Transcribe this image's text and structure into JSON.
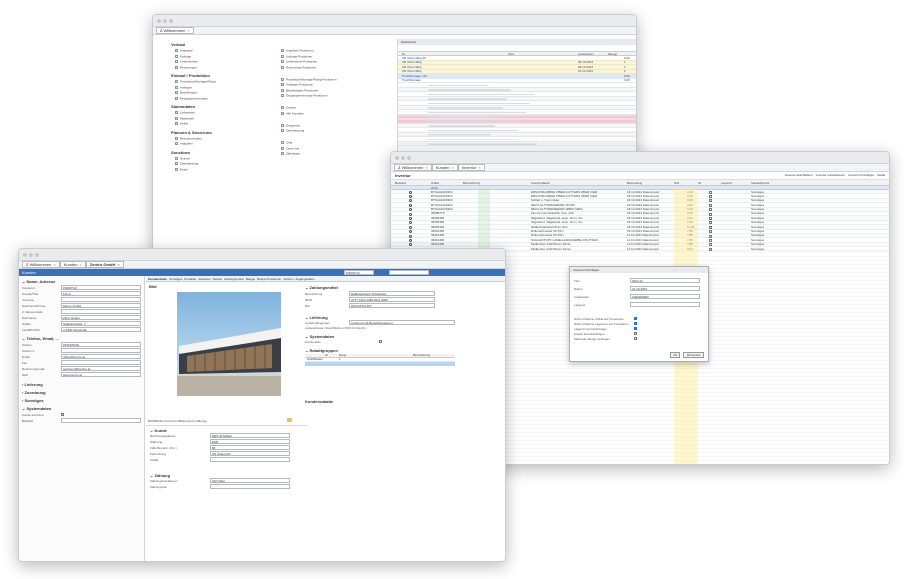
{
  "back_window": {
    "tab_label": "Willkommen",
    "dashboard": {
      "sections": [
        {
          "title": "Verkauf",
          "items": [
            "Angebote",
            "Aufträge",
            "Lieferscheine",
            "Rechnungen"
          ]
        },
        {
          "title": "Einkauf / Produktion",
          "items": [
            "Produktion/Montage/Rüstg",
            "Anfragen",
            "Bestellungen",
            "Eingangsrechnungen"
          ]
        },
        {
          "title": "Stammdaten",
          "items": [
            "Lieferanten",
            "Mitarbeiter",
            "Artikel"
          ]
        },
        {
          "title": "Planung & Steuerung",
          "items": [
            "Ressourcenplan",
            "Aufgaben"
          ]
        },
        {
          "title": "Sonstiges",
          "items": [
            "Notizen",
            "Zeiterfassung",
            "Email"
          ]
        }
      ],
      "right_items": [
        "Angebots-Positionen",
        "Auftrags-Positionen",
        "Lieferschein-Positionen",
        "Rechnungs-Positionen",
        "Produktion/Montage/Rüstg-Positionen",
        "Anfragen-Positionen",
        "Bestellungen-Positionen",
        "Eingangsrechnungs-Positionen",
        "Kunden",
        "Alle Kontakte",
        "Ereignisse",
        "Zeiterfassung",
        "Chat",
        "Zeiten bis",
        "Zahlungen"
      ],
      "list_header": "Dashboard",
      "list_columns": [
        "Nr.",
        "Titel",
        "Lieferdatum",
        "Menge"
      ],
      "list_rows": [
        {
          "c": "AB Übermäßig 35",
          "d": "",
          "q": "0,00"
        },
        {
          "c": "AB Übermäßig",
          "d": "09.10.2024",
          "q": "1"
        },
        {
          "c": "AB Übermäßig",
          "d": "09.10.2024",
          "q": "1"
        },
        {
          "c": "AB Übermäßig",
          "d": "10.11.2024",
          "q": "1"
        },
        {
          "c": "Prod/Montage 179",
          "d": "",
          "q": "0,00"
        },
        {
          "c": "Prod/Montage",
          "d": "",
          "q": "0,00"
        }
      ]
    }
  },
  "inventory_window": {
    "tabs": [
      "Willkommen",
      "Kunden",
      "Inventur"
    ],
    "title": "Inventur",
    "toolbar": [
      "Inventur abschließen",
      "Inventur zurücksetzen",
      "Inventur hinzufügen",
      "Detail"
    ],
    "columns": [
      "Bestand",
      "Artikel",
      "Bezeichnung",
      "Inventurdatum",
      "Bemerkung",
      "Soll",
      "Ist",
      "Lagerort",
      "Verkaufspreis"
    ],
    "rows": [
      {
        "a": "BTSAA1626303",
        "b": "EBS4728LGB66H FIBER-CUTTERS 18MM (VER",
        "d": "18.10.2024 Datenimport",
        "s": "3,29",
        "l": "Sonstiges"
      },
      {
        "a": "BTSAA1626303",
        "b": "EBS4728LGB66H FIBER-CUTTERS 18MM (VER",
        "d": "18.10.2024 Datenimport",
        "s": "3,29",
        "l": "Sonstiges"
      },
      {
        "a": "BTSAA1626303",
        "b": "Schleif u. Trennmittel",
        "d": "18.10.2024 Datenimport",
        "s": "3,29",
        "l": "Sonstiges"
      },
      {
        "a": "BTSAA1626303",
        "b": "REC3-GUTTERKEEPER 18 MM",
        "d": "18.10.2024 Datenimport",
        "s": "3,29",
        "l": "Sonstiges"
      },
      {
        "a": "BTSAA1626303",
        "b": "REC3-GUTTERKEEPER 18MM (VER)",
        "d": "18.10.2024 Datenimport",
        "s": "3,29",
        "l": "Sonstiges"
      },
      {
        "a": "366887T6",
        "b": "Zimmermannsbleistift, lose, 24S",
        "d": "18.10.2024 Datenimport",
        "s": "0,69",
        "l": "Sonstiges"
      },
      {
        "a": "36665483",
        "b": "Sägeband, Sägeband, ansp. 4mm, 3m",
        "d": "18.10.2024 Datenimport",
        "s": "4,61",
        "l": "Sonstiges"
      },
      {
        "a": "36665483",
        "b": "Sägeband, Sägeband, ansp. 4mm, 3m",
        "d": "18.10.2024 Datenimport",
        "s": "2,09",
        "l": "Sonstiges"
      },
      {
        "a": "36665483",
        "b": "Nahlschraubkopf 8mm 10m",
        "d": "18.10.2024 Datenimport",
        "s": "11,39",
        "l": "Sonstiges"
      },
      {
        "a": "36661483",
        "b": "Rollenschneider A5 25m",
        "d": "18.10.2024 Datenimport",
        "s": "7,85",
        "l": "Sonstiges"
      },
      {
        "a": "36661483",
        "b": "Rollenschneider A5 25m",
        "d": "11.10.2024 Datenimport",
        "s": "7,85",
        "l": "Sonstiges"
      },
      {
        "a": "36661483",
        "b": "SCHLEIFTOPF LAMELLENSCHEIBE K36 ZTRAK.",
        "d": "11.10.2024 Datenimport",
        "s": "7,85",
        "l": "Sonstiges"
      },
      {
        "a": "36661483",
        "b": "Mollbecher 24W 80mm 46mm",
        "d": "11.10.2024 Datenimport",
        "s": "7,85",
        "l": "Sonstiges"
      },
      {
        "a": "36661483",
        "b": "Mollbecher 24W 80mm 46mm",
        "d": "11.10.2024 Datenimport",
        "s": "9,07",
        "l": "Sonstiges"
      },
      {
        "a": "36661483",
        "b": "Holzlamelle, 40 mm, Breite 80 mm",
        "d": "11.10.2024 Datenimport",
        "s": "31,98",
        "l": "Sonstiges"
      },
      {
        "a": "36661483",
        "b": "Holzlamelle, 40 mm, Breite 80 mm",
        "d": "11.10.2024 Datenimport",
        "s": "12,27",
        "l": "Sonstiges"
      }
    ],
    "dialog": {
      "title": "Inventur hinzufügen",
      "fields": [
        {
          "label": "Titel",
          "value": "2024-11"
        },
        {
          "label": "Datum",
          "value": "31.10.2024"
        },
        {
          "label": "Lieferanten",
          "value": "LIEFERSER"
        },
        {
          "label": "Lagerort",
          "value": ""
        }
      ],
      "options": [
        "Nicht erhaltene Artikel auf 0 bestehen",
        "Nicht erhaltene Lagerorte auf 0 bestehen",
        "Lagerort berücksichtigen",
        "Zusatz berücksichtigen",
        "Maximale Menge festlegen"
      ],
      "ok": "OK",
      "cancel": "Abbrechen"
    }
  },
  "customer_window": {
    "tabs": [
      "Willkommen",
      "Kunden",
      "Zentro GmbH"
    ],
    "title": "Kunden",
    "record_nr": "P0000712",
    "toolbar_tabs": [
      "Kundendaten",
      "Sonstiges",
      "Kontakte",
      "Adressen, Telefon",
      "Zahlungsmittel",
      "Belege",
      "Belegs-Positionen",
      "Notizen",
      "Zugangsdaten"
    ],
    "left": {
      "section_name": "Name, Adresse",
      "fields": [
        {
          "label": "Kundennr.",
          "value": "P0000712"
        },
        {
          "label": "Anrede/Titel",
          "value": "Firma"
        },
        {
          "label": "Vorname",
          "value": ""
        },
        {
          "label": "Nachname/Firma",
          "value": "Zentro GmbH"
        },
        {
          "label": "2. Namenszeile",
          "value": ""
        },
        {
          "label": "Suchname",
          "value": "Zentr GmbH"
        },
        {
          "label": "Straße",
          "value": "Südbahnhofstr. 7"
        },
        {
          "label": "Land/PLZ/Ort",
          "value": "A   4840   Schwindel"
        }
      ],
      "section_contact": "Telefon, Email, ...",
      "contact_fields": [
        {
          "label": "Telefon",
          "value": "07615/5216"
        },
        {
          "label": "Telefon 2",
          "value": ""
        },
        {
          "label": "Email",
          "value": "office@zentro.at"
        },
        {
          "label": "Fax",
          "value": ""
        },
        {
          "label": "Rechnungsemail",
          "value": "rechnung@zentro.at"
        },
        {
          "label": "Web",
          "value": "www.zentro.at"
        }
      ],
      "collapsed": [
        "Lieferung",
        "Zuordnung",
        "Sonstiges"
      ],
      "section_system": "Systemdaten",
      "system_fields": [
        {
          "label": "Kunde archiviert",
          "value": ""
        },
        {
          "label": "Bildpfad",
          "value": ""
        }
      ]
    },
    "image_block": {
      "title": "Bild",
      "path": "Bild/Bild\\Zentro\\Zentro\\Bilder\\Zentro-Bild.jpg"
    },
    "payment": {
      "title": "Zahlungsmittel",
      "fields": [
        {
          "label": "Bezeichnung",
          "value": "Raiffeisenbank Schwindau"
        },
        {
          "label": "IBAN",
          "value": "AT77 3412 0048 0011 0056"
        },
        {
          "label": "BIC",
          "value": "RZOOAT2L157"
        }
      ]
    },
    "delivery": {
      "title": "Lieferung",
      "fields": [
        {
          "label": "Lieferbedingungen",
          "value": "Lieferung mit Bezahlanweisung"
        },
        {
          "label": "Lieferadresse / Zentr.Buchen (50% für Rechn.)",
          "value": ""
        }
      ]
    },
    "system2": {
      "title": "Systemdaten",
      "fields": [
        {
          "label": "Kunde aktiv",
          "value": ""
        }
      ]
    },
    "groups": {
      "title": "Rabattgruppen",
      "columns": [
        "Id",
        "Rang",
        "Bezeichnung"
      ],
      "rows": [
        {
          "id": "Stufflakader",
          "rang": "1",
          "name": ""
        }
      ]
    },
    "discounts": {
      "title": "Kundenrabatte"
    },
    "customer": {
      "title": "Kunde",
      "fields": [
        {
          "label": "Rechnungsadresse",
          "value": "MRT-Schrilltag"
        },
        {
          "label": "Währung",
          "value": "EUR"
        },
        {
          "label": "Fälle Bemerk. (Kto.)",
          "value": "50"
        },
        {
          "label": "Verbuchung",
          "value": "NS Österreich"
        },
        {
          "label": "ZAHE",
          "value": ""
        }
      ]
    },
    "terms": {
      "title": "Zahlung",
      "fields": [
        {
          "label": "Zahlungskonditionen",
          "value": "UST-Satz"
        },
        {
          "label": "Zahlungsziel",
          "value": ""
        }
      ]
    }
  }
}
